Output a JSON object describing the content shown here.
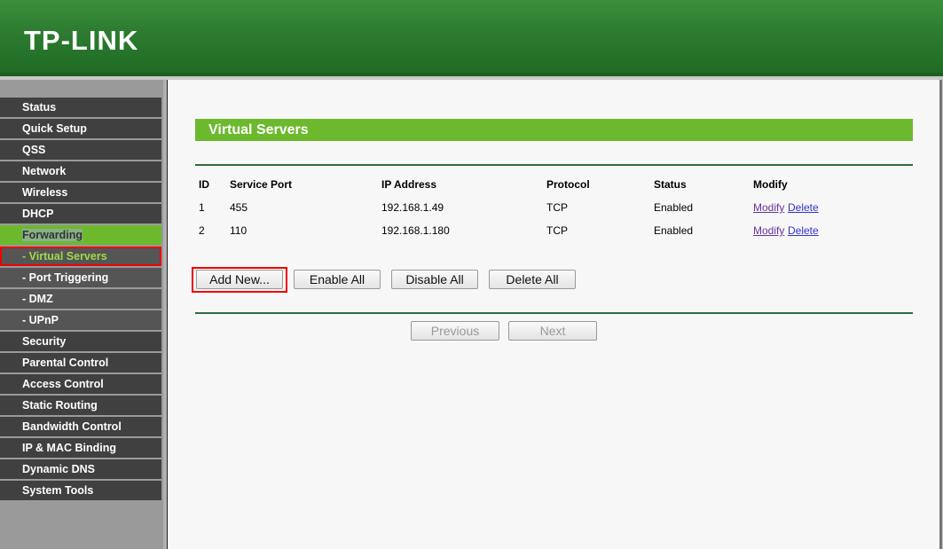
{
  "brand": "TP-LINK",
  "sidebar": {
    "items": [
      {
        "label": "Status"
      },
      {
        "label": "Quick Setup"
      },
      {
        "label": "QSS"
      },
      {
        "label": "Network"
      },
      {
        "label": "Wireless"
      },
      {
        "label": "DHCP"
      },
      {
        "label": "Forwarding"
      },
      {
        "label": "- Virtual Servers"
      },
      {
        "label": "- Port Triggering"
      },
      {
        "label": "- DMZ"
      },
      {
        "label": "- UPnP"
      },
      {
        "label": "Security"
      },
      {
        "label": "Parental Control"
      },
      {
        "label": "Access Control"
      },
      {
        "label": "Static Routing"
      },
      {
        "label": "Bandwidth Control"
      },
      {
        "label": "IP & MAC Binding"
      },
      {
        "label": "Dynamic DNS"
      },
      {
        "label": "System Tools"
      }
    ]
  },
  "main": {
    "title": "Virtual Servers",
    "headers": [
      "ID",
      "Service Port",
      "IP Address",
      "Protocol",
      "Status",
      "Modify"
    ],
    "rows": [
      {
        "id": "1",
        "port": "455",
        "ip": "192.168.1.49",
        "protocol": "TCP",
        "status": "Enabled",
        "modify": "Modify",
        "delete": "Delete"
      },
      {
        "id": "2",
        "port": "110",
        "ip": "192.168.1.180",
        "protocol": "TCP",
        "status": "Enabled",
        "modify": "Modify",
        "delete": "Delete"
      }
    ],
    "buttons": {
      "add": "Add New...",
      "enable_all": "Enable All",
      "disable_all": "Disable All",
      "delete_all": "Delete All",
      "previous": "Previous",
      "next": "Next"
    }
  }
}
